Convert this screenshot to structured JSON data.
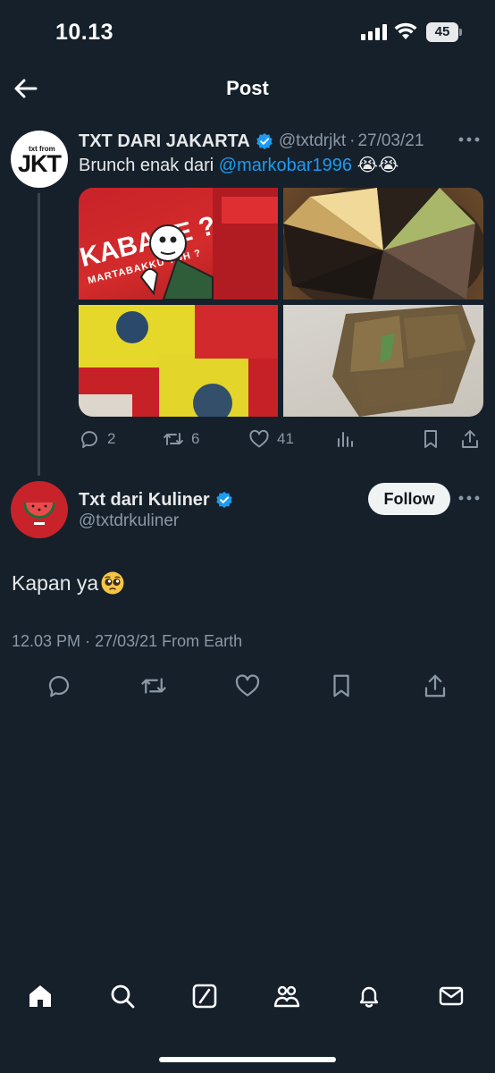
{
  "status_bar": {
    "time": "10.13",
    "battery": "45"
  },
  "header": {
    "title": "Post"
  },
  "parent_tweet": {
    "avatar_small": "txt from",
    "avatar_big": "JKT",
    "name": "TXT DARI JAKARTA",
    "handle": "@txtdrjkt",
    "date": "27/03/21",
    "separator": "·",
    "text_prefix": "Brunch enak dari ",
    "mention": "@markobar1996",
    "text_suffix": " 😭😭",
    "media_captions": {
      "box_text": "KABARE ?",
      "box_subtext": "MARTABAKKU TOH ?"
    },
    "replies": "2",
    "retweets": "6",
    "likes": "41"
  },
  "reply_tweet": {
    "name": "Txt dari Kuliner",
    "handle": "@txtdrkuliner",
    "follow_label": "Follow",
    "text": "Kapan ya",
    "time": "12.03 PM",
    "date": "27/03/21",
    "separator": "·",
    "source": "From Earth"
  },
  "colors": {
    "background": "#15202b",
    "accent": "#1d9bf0",
    "secondary_text": "#8b98a5",
    "primary_text": "#e7e9ea"
  },
  "icons": [
    "back-arrow-icon",
    "verified-icon",
    "more-icon",
    "reply-icon",
    "retweet-icon",
    "like-icon",
    "views-icon",
    "bookmark-icon",
    "share-icon",
    "home-icon",
    "search-icon",
    "grok-icon",
    "communities-icon",
    "notifications-icon",
    "messages-icon"
  ]
}
